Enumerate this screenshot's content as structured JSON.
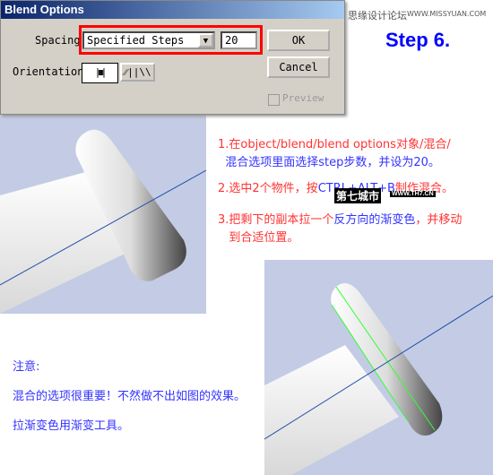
{
  "dialog": {
    "title": "Blend Options",
    "spacing_label": "Spacing:",
    "spacing_value": "Specified Steps",
    "steps_value": "20",
    "orientation_label": "Orientation:",
    "ok": "OK",
    "cancel": "Cancel",
    "preview": "Preview",
    "preview_checked": false,
    "highlight_color": "#ff0000"
  },
  "watermark": {
    "site_cn": "思缘设计论坛",
    "site_url": "WWW.MISSYUAN.COM",
    "overlay_cn": "第七城市",
    "overlay_url": "WWW.TH7.CN"
  },
  "step_title": "Step 6.",
  "instructions": {
    "s1a": "1.在object/blend/blend options对象/混合/",
    "s1b": "混合选项里面选择step步数，并设为20。",
    "s2a": "2.选中2个物件，按",
    "s2b": "CTRL+ALT+B",
    "s2c": "制作混合。",
    "s3a": "3.把剩下的副本拉一个",
    "s3b": "反方向的渐变色",
    "s3c": "，并移动",
    "s3d": "到合适位置。"
  },
  "notes": {
    "title": "注意:",
    "line1": "混合的选项很重要！不然做不出如图的效果。",
    "line2": "拉渐变色用渐变工具。"
  },
  "colors": {
    "red_text": "#ff3333",
    "blue_text": "#3333ff",
    "panel_bg": "#c3cce4",
    "step_blue": "#0000ff"
  }
}
